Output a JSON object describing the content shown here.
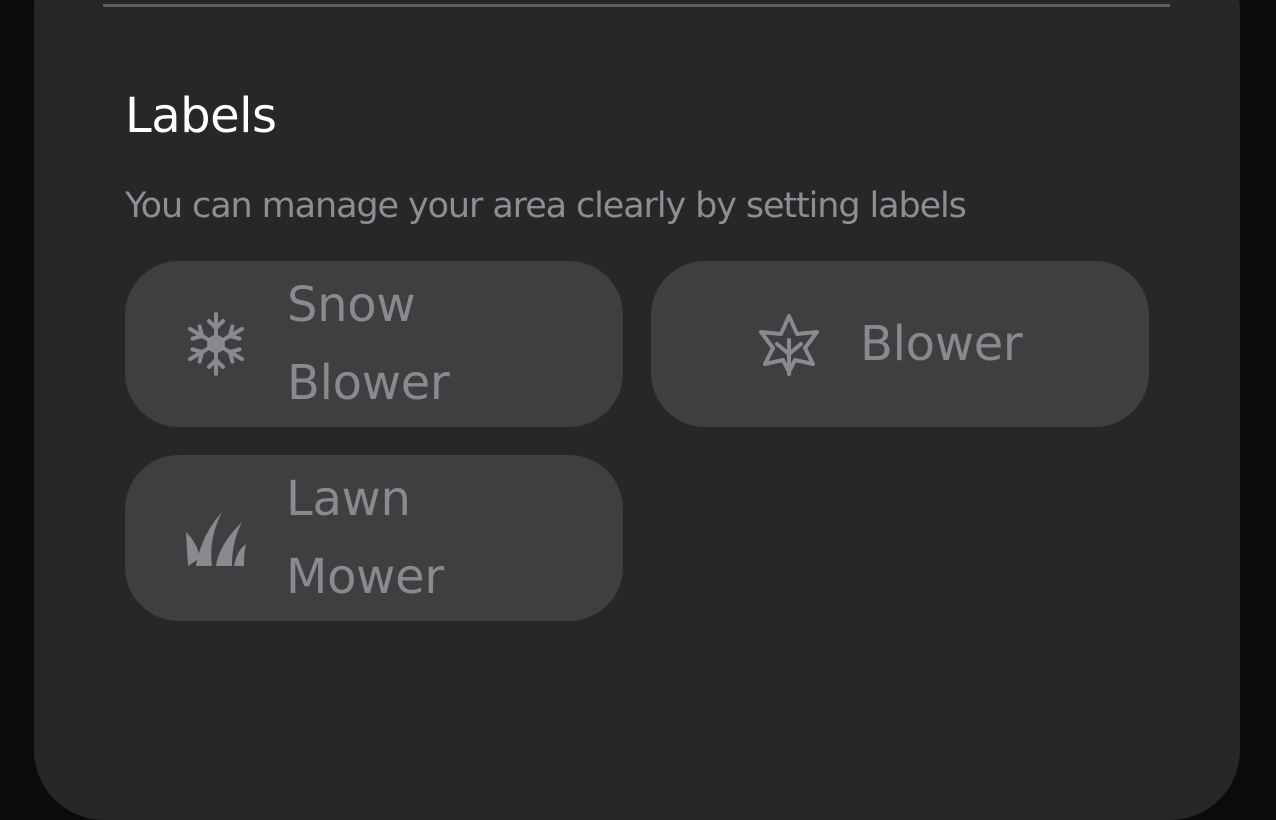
{
  "section": {
    "title": "Labels",
    "description": "You can manage your area clearly by setting labels"
  },
  "labels": [
    {
      "icon": "snowflake-icon",
      "line1": "Snow",
      "line2": "Blower"
    },
    {
      "icon": "leaf-icon",
      "line1": "Blower"
    },
    {
      "icon": "grass-icon",
      "line1": "Lawn",
      "line2": "Mower"
    }
  ],
  "colors": {
    "background": "#0b0b0c",
    "card": "#272729",
    "chip": "#3f3f42",
    "title": "#ffffff",
    "muted_text": "#8e8e92",
    "chip_text": "#8a8a8e"
  }
}
